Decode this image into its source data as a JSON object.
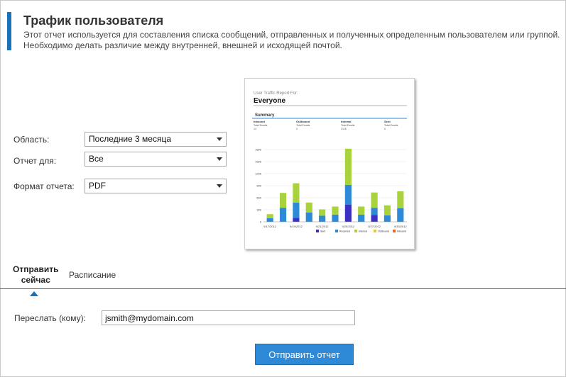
{
  "header": {
    "title": "Трафик пользователя",
    "description_line1": "Этот отчет используется для составления списка сообщений, отправленных и полученных определенным пользователем или группой.",
    "description_line2": "Необходимо делать различие между внутренней, внешней и исходящей почтой."
  },
  "form": {
    "scope_label": "Область:",
    "scope_value": "Последние 3 месяца",
    "report_for_label": "Отчет для:",
    "report_for_value": "Все",
    "format_label": "Формат отчета:",
    "format_value": "PDF"
  },
  "preview": {
    "header_small": "User Traffic Report For:",
    "header_big": "Everyone",
    "summary_title": "Summary",
    "summary_cols": [
      {
        "name": "Inbound",
        "sub": "Total Emails",
        "val": "14"
      },
      {
        "name": "Outbound",
        "sub": "Total Emails",
        "val": "0"
      },
      {
        "name": "Internal",
        "sub": "Total Emails",
        "val": "2116"
      },
      {
        "name": "Sent",
        "sub": "Total Emails",
        "val": "0"
      }
    ],
    "chart_data": {
      "type": "bar",
      "stacked": true,
      "categories": [
        "9/17/2012",
        "",
        "9/19/2012",
        "",
        "9/21/2012",
        "",
        "9/25/2012",
        "",
        "9/27/2012",
        "",
        "9/30/2012"
      ],
      "y_ticks": [
        "0",
        "300",
        "600",
        "900",
        "1200",
        "1500",
        "1800"
      ],
      "ylim": [
        0,
        1800
      ],
      "series": [
        {
          "name": "Sent",
          "color": "#3b2fc4",
          "values": [
            0,
            0,
            100,
            0,
            0,
            0,
            430,
            0,
            170,
            0,
            0
          ]
        },
        {
          "name": "Received",
          "color": "#2e8ad6",
          "values": [
            90,
            350,
            380,
            230,
            150,
            180,
            490,
            180,
            180,
            160,
            340
          ]
        },
        {
          "name": "Internal",
          "color": "#a8d33c",
          "values": [
            100,
            370,
            480,
            250,
            160,
            200,
            900,
            200,
            380,
            250,
            420
          ]
        },
        {
          "name": "Outbound",
          "color": "#f2c230",
          "values": [
            0,
            0,
            0,
            0,
            0,
            0,
            0,
            0,
            0,
            0,
            0
          ]
        },
        {
          "name": "Inbound",
          "color": "#f06a1c",
          "values": [
            0,
            0,
            0,
            0,
            0,
            0,
            0,
            0,
            0,
            0,
            0
          ]
        }
      ]
    }
  },
  "tabs": {
    "send_now_line1": "Отправить",
    "send_now_line2": "сейчас",
    "schedule": "Расписание"
  },
  "send": {
    "forward_label": "Переслать (кому):",
    "email_value": "jsmith@mydomain.com",
    "button_label": "Отправить отчет"
  }
}
